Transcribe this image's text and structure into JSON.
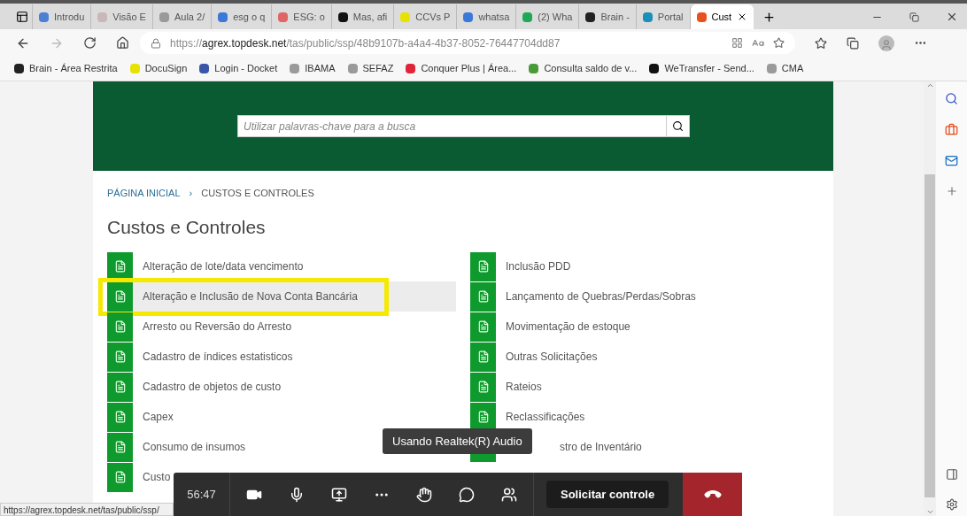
{
  "browser": {
    "tabs": [
      {
        "label": "Introdu",
        "color": "#4a7fd4",
        "selected": false
      },
      {
        "label": "Visão E",
        "color": "#c9b8b8",
        "selected": false
      },
      {
        "label": "Aula 2/",
        "color": "#9a9a9a",
        "selected": false
      },
      {
        "label": "esg o q",
        "color": "#3b78d8",
        "selected": false
      },
      {
        "label": "ESG: o",
        "color": "#e06666",
        "selected": false
      },
      {
        "label": "Mas, afi",
        "color": "#111111",
        "selected": false
      },
      {
        "label": "CCVs P",
        "color": "#e8e200",
        "selected": false
      },
      {
        "label": "whatsa",
        "color": "#3b78d8",
        "selected": false
      },
      {
        "label": "(2) Wha",
        "color": "#1fa855",
        "selected": false
      },
      {
        "label": "Brain -",
        "color": "#222222",
        "selected": false
      },
      {
        "label": "Portal",
        "color": "#1b8fb8",
        "selected": false
      },
      {
        "label": "Cust",
        "color": "#e8501e",
        "selected": true
      }
    ],
    "url": {
      "scheme": "https://",
      "host": "agrex.topdesk.net",
      "path": "/tas/public/ssp/48b9107b-a4a4-4b37-8052-76447704dd87"
    },
    "bookmarks": [
      {
        "label": "Brain - Área Restrita",
        "color": "#222222"
      },
      {
        "label": "DocuSign",
        "color": "#e8e200"
      },
      {
        "label": "Login - Docket",
        "color": "#3a56a8"
      },
      {
        "label": "IBAMA",
        "color": "#9a9a9a"
      },
      {
        "label": "SEFAZ",
        "color": "#9a9a9a"
      },
      {
        "label": "Conquer Plus | Área...",
        "color": "#e0253a"
      },
      {
        "label": "Consulta saldo de v...",
        "color": "#4a9a3a"
      },
      {
        "label": "WeTransfer - Send...",
        "color": "#111111"
      },
      {
        "label": "CMA",
        "color": "#9a9a9a"
      }
    ],
    "status_url": "https://agrex.topdesk.net/tas/public/ssp/"
  },
  "page": {
    "search": {
      "placeholder": "Utilizar palavras-chave para a busca"
    },
    "breadcrumb": [
      "PÁGINA INICIAL",
      "›",
      "CUSTOS E CONTROLES"
    ],
    "title": "Custos e Controles",
    "columns": [
      [
        {
          "label": "Alteração de lote/data vencimento",
          "selected": false
        },
        {
          "label": "Alteração e Inclusão de Nova Conta Bancária",
          "selected": true
        },
        {
          "label": "Arresto ou Reversão do Arresto",
          "selected": false
        },
        {
          "label": "Cadastro de índices estatisticos",
          "selected": false
        },
        {
          "label": "Cadastro de objetos de custo",
          "selected": false
        },
        {
          "label": "Capex",
          "selected": false
        },
        {
          "label": "Consumo de insumos",
          "selected": false
        },
        {
          "label": "Custo",
          "selected": false
        }
      ],
      [
        {
          "label": "Inclusão PDD",
          "selected": false
        },
        {
          "label": "Lançamento de Quebras/Perdas/Sobras",
          "selected": false
        },
        {
          "label": "Movimentação de estoque",
          "selected": false
        },
        {
          "label": "Outras Solicitações",
          "selected": false
        },
        {
          "label": "Rateios",
          "selected": false
        },
        {
          "label": "Reclassificações",
          "selected": false
        },
        {
          "label": "stro de Inventário",
          "selected": false
        }
      ]
    ]
  },
  "meeting": {
    "timer": "56:47",
    "tooltip": "Usando Realtek(R) Audio",
    "control_button": "Solicitar controle"
  }
}
